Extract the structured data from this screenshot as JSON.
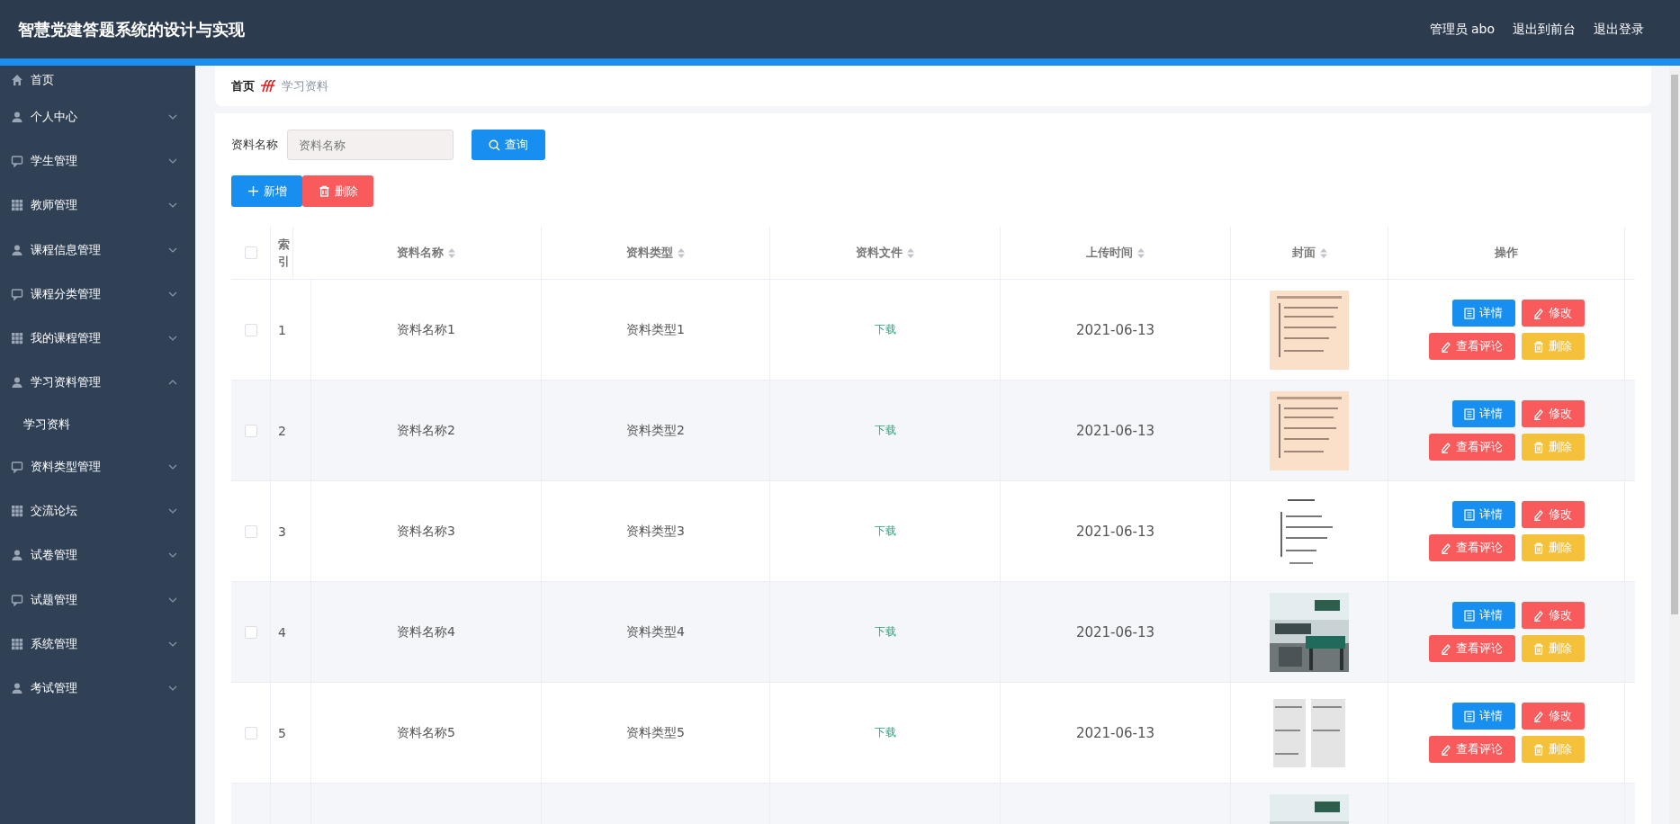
{
  "header": {
    "title": "智慧党建答题系统的设计与实现",
    "links": [
      "管理员 abo",
      "退出到前台",
      "退出登录"
    ]
  },
  "sidebar": {
    "items": [
      {
        "label": "首页"
      },
      {
        "label": "个人中心",
        "expanded": false
      },
      {
        "label": "学生管理",
        "expanded": false
      },
      {
        "label": "教师管理",
        "expanded": false
      },
      {
        "label": "课程信息管理",
        "expanded": false
      },
      {
        "label": "课程分类管理",
        "expanded": false
      },
      {
        "label": "我的课程管理",
        "expanded": false
      },
      {
        "label": "学习资料管理",
        "expanded": true,
        "children": [
          {
            "label": "学习资料"
          }
        ]
      },
      {
        "label": "资料类型管理",
        "expanded": false
      },
      {
        "label": "交流论坛",
        "expanded": false
      },
      {
        "label": "试卷管理",
        "expanded": false
      },
      {
        "label": "试题管理",
        "expanded": false
      },
      {
        "label": "系统管理",
        "expanded": false
      },
      {
        "label": "考试管理",
        "expanded": false
      }
    ]
  },
  "breadcrumb": [
    "首页",
    "学习资料"
  ],
  "search": {
    "label": "资料名称",
    "placeholder": "资料名称",
    "button": "查询"
  },
  "actions": [
    {
      "label": "新增",
      "kind": "add"
    },
    {
      "label": "删除",
      "kind": "delete"
    }
  ],
  "table": {
    "header_checked": false,
    "columns": [
      {
        "label": "索引",
        "sortable": false
      },
      {
        "label": "资料名称",
        "sortable": true
      },
      {
        "label": "资料类型",
        "sortable": true
      },
      {
        "label": "资料文件",
        "sortable": true
      },
      {
        "label": "上传时间",
        "sortable": true
      },
      {
        "label": "封面",
        "sortable": true
      },
      {
        "label": "操作",
        "sortable": false
      }
    ],
    "rows": [
      {
        "checked": false,
        "index": "1",
        "name": "资料名称1",
        "type": "资料类型1",
        "file": "下载",
        "time": "2021-06-13",
        "buttons": [
          {
            "label": "详情",
            "kind": "detail"
          },
          {
            "label": "修改",
            "kind": "edit"
          },
          {
            "label": "查看评论",
            "kind": "comment"
          },
          {
            "label": "删除",
            "kind": "delete"
          }
        ]
      },
      {
        "checked": false,
        "index": "2",
        "name": "资料名称2",
        "type": "资料类型2",
        "file": "下载",
        "time": "2021-06-13",
        "buttons": [
          {
            "label": "详情",
            "kind": "detail"
          },
          {
            "label": "修改",
            "kind": "edit"
          },
          {
            "label": "查看评论",
            "kind": "comment"
          },
          {
            "label": "删除",
            "kind": "delete"
          }
        ]
      },
      {
        "checked": false,
        "index": "3",
        "name": "资料名称3",
        "type": "资料类型3",
        "file": "下载",
        "time": "2021-06-13",
        "buttons": [
          {
            "label": "详情",
            "kind": "detail"
          },
          {
            "label": "修改",
            "kind": "edit"
          },
          {
            "label": "查看评论",
            "kind": "comment"
          },
          {
            "label": "删除",
            "kind": "delete"
          }
        ]
      },
      {
        "checked": false,
        "index": "4",
        "name": "资料名称4",
        "type": "资料类型4",
        "file": "下载",
        "time": "2021-06-13",
        "buttons": [
          {
            "label": "详情",
            "kind": "detail"
          },
          {
            "label": "修改",
            "kind": "edit"
          },
          {
            "label": "查看评论",
            "kind": "comment"
          },
          {
            "label": "删除",
            "kind": "delete"
          }
        ]
      },
      {
        "checked": false,
        "index": "5",
        "name": "资料名称5",
        "type": "资料类型5",
        "file": "下载",
        "time": "2021-06-13",
        "buttons": [
          {
            "label": "详情",
            "kind": "detail"
          },
          {
            "label": "修改",
            "kind": "edit"
          },
          {
            "label": "查看评论",
            "kind": "comment"
          },
          {
            "label": "删除",
            "kind": "delete"
          }
        ]
      }
    ]
  }
}
